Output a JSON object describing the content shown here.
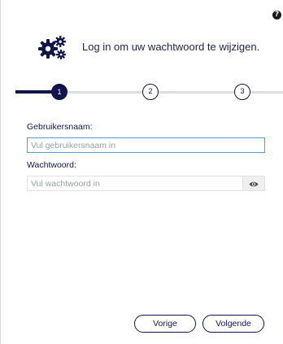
{
  "help": {
    "icon": "question-circle-icon",
    "glyph": "?"
  },
  "header": {
    "icon": "gears-icon",
    "text": "Log in om uw wachtwoord te wijzigen."
  },
  "stepper": {
    "current": 1,
    "steps": [
      {
        "label": "1",
        "state": "active"
      },
      {
        "label": "2",
        "state": "inactive"
      },
      {
        "label": "3",
        "state": "inactive"
      }
    ]
  },
  "form": {
    "username": {
      "label": "Gebruikersnaam:",
      "placeholder": "Vul gebruikersnaam in",
      "value": ""
    },
    "password": {
      "label": "Wachtwoord:",
      "placeholder": "Vul wachtwoord in",
      "value": "",
      "toggle_icon": "eye-icon"
    }
  },
  "buttons": {
    "previous": "Vorige",
    "next": "Volgende"
  },
  "colors": {
    "accent": "#12154a",
    "focus": "#5b9bd5",
    "track": "#dedede"
  }
}
